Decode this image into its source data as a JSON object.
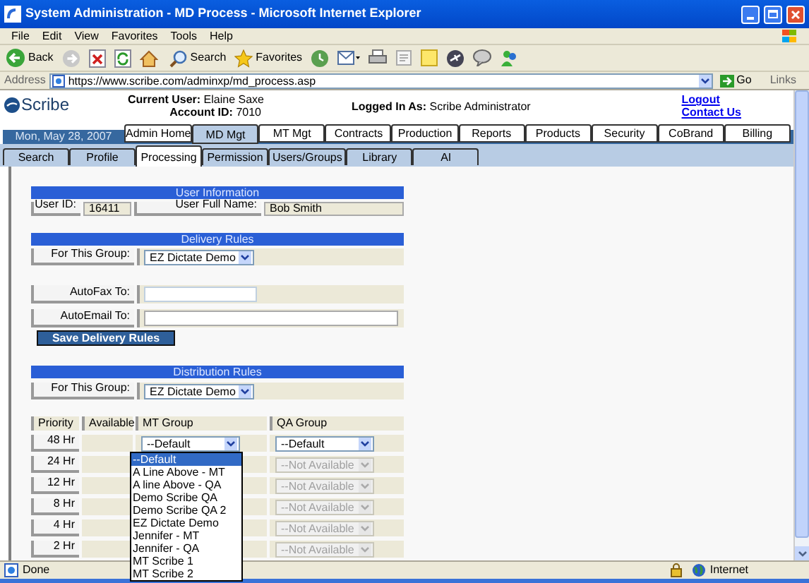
{
  "window": {
    "title": "System Administration - MD Process - Microsoft Internet Explorer"
  },
  "menu": [
    "File",
    "Edit",
    "View",
    "Favorites",
    "Tools",
    "Help"
  ],
  "toolbar": {
    "back": "Back",
    "search": "Search",
    "favorites": "Favorites"
  },
  "address_bar": {
    "label": "Address",
    "url": "https://www.scribe.com/adminxp/md_process.asp",
    "go": "Go",
    "links": "Links"
  },
  "header": {
    "logo": "Scribe",
    "user_label": "Current User:",
    "user": "Elaine Saxe",
    "account_label": "Account ID:",
    "account": "7010",
    "logged_label": "Logged In As:",
    "logged": "Scribe Administrator",
    "links": [
      "Logout",
      "Contact Us"
    ],
    "date": "Mon, May 28, 2007"
  },
  "main_tabs": [
    {
      "label": "Admin Home",
      "selected": false
    },
    {
      "label": "MD Mgt",
      "selected": true
    },
    {
      "label": "MT Mgt",
      "selected": false
    },
    {
      "label": "Contracts",
      "selected": false
    },
    {
      "label": "Production",
      "selected": false
    },
    {
      "label": "Reports",
      "selected": false
    },
    {
      "label": "Products",
      "selected": false
    },
    {
      "label": "Security",
      "selected": false
    },
    {
      "label": "CoBrand",
      "selected": false
    },
    {
      "label": "Billing",
      "selected": false
    }
  ],
  "sub_tabs": [
    {
      "label": "Search",
      "selected": false
    },
    {
      "label": "Profile",
      "selected": false
    },
    {
      "label": "Processing",
      "selected": true
    },
    {
      "label": "Permission",
      "selected": false
    },
    {
      "label": "Users/Groups",
      "selected": false
    },
    {
      "label": "Library",
      "selected": false
    },
    {
      "label": "AI",
      "selected": false
    }
  ],
  "user_info": {
    "title": "User Information",
    "id_label": "User ID:",
    "id": "16411",
    "name_label": "User Full Name:",
    "name": "Bob Smith"
  },
  "delivery": {
    "title": "Delivery Rules",
    "group_label": "For This Group:",
    "group": "EZ Dictate Demo",
    "autofax_label": "AutoFax To:",
    "autoemail_label": "AutoEmail To:",
    "save": "Save Delivery Rules"
  },
  "distribution": {
    "title": "Distribution Rules",
    "group_label": "For This Group:",
    "group": "EZ Dictate Demo",
    "columns": [
      "Priority",
      "Available",
      "MT Group",
      "QA Group"
    ],
    "rows": [
      {
        "priority": "48 Hr",
        "mt": "--Default",
        "qa": "--Default",
        "disabled": false
      },
      {
        "priority": "24 Hr",
        "qa": "--Not Available",
        "disabled": true
      },
      {
        "priority": "12 Hr",
        "qa": "--Not Available",
        "disabled": true
      },
      {
        "priority": "8 Hr",
        "qa": "--Not Available",
        "disabled": true
      },
      {
        "priority": "4 Hr",
        "qa": "--Not Available",
        "disabled": true
      },
      {
        "priority": "2 Hr",
        "qa": "--Not Available",
        "disabled": true
      }
    ]
  },
  "dropdown": [
    {
      "label": "--Default",
      "selected": true
    },
    {
      "label": "A Line Above - MT",
      "selected": false
    },
    {
      "label": "A line Above - QA",
      "selected": false
    },
    {
      "label": "Demo Scribe QA",
      "selected": false
    },
    {
      "label": "Demo Scribe QA 2",
      "selected": false
    },
    {
      "label": "EZ Dictate Demo",
      "selected": false
    },
    {
      "label": "Jennifer - MT",
      "selected": false
    },
    {
      "label": "Jennifer - QA",
      "selected": false
    },
    {
      "label": "MT Scribe 1",
      "selected": false
    },
    {
      "label": "MT Scribe 2",
      "selected": false
    }
  ],
  "status_bar": {
    "text": "Done",
    "zone": "Internet"
  }
}
